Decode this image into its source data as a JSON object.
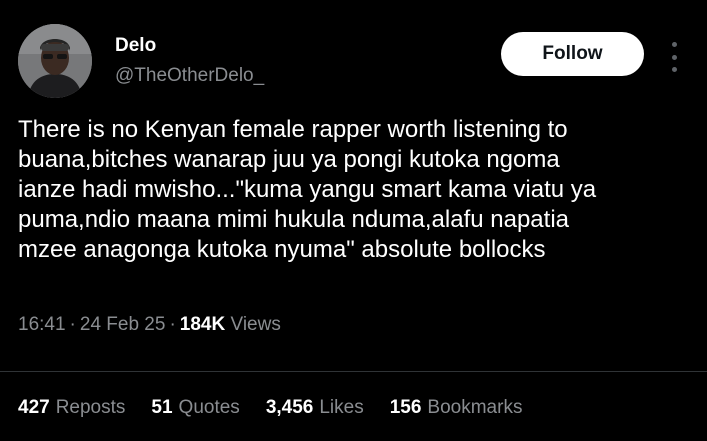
{
  "author": {
    "name": "Delo",
    "handle": "@TheOtherDelo_"
  },
  "follow_button": {
    "label": "Follow"
  },
  "more_icon": "more-vertical-icon",
  "tweet": {
    "text": "There is no Kenyan female rapper worth listening to\nbuana,bitches wanarap juu ya pongi kutoka ngoma\nianze hadi mwisho...\"kuma yangu smart kama viatu ya\npuma,ndio maana mimi hukula nduma,alafu napatia\nmzee anagonga kutoka nyuma\" absolute bollocks"
  },
  "meta": {
    "time": "16:41",
    "date": "24 Feb 25",
    "views_count": "184K",
    "views_label": "Views",
    "separator": "·"
  },
  "stats": {
    "reposts": {
      "count": "427",
      "label": "Reposts"
    },
    "quotes": {
      "count": "51",
      "label": "Quotes"
    },
    "likes": {
      "count": "3,456",
      "label": "Likes"
    },
    "bookmarks": {
      "count": "156",
      "label": "Bookmarks"
    }
  },
  "colors": {
    "background": "#000000",
    "primary_text": "#ffffff",
    "secondary_text": "#8a8d91",
    "button_bg": "#ffffff",
    "button_text": "#0f1419",
    "divider": "#2f3336"
  }
}
